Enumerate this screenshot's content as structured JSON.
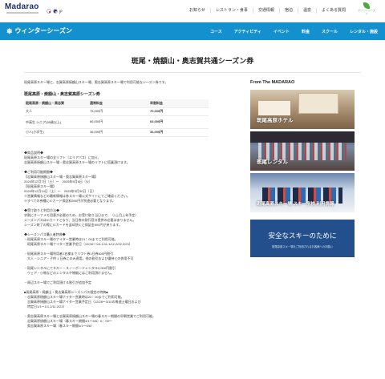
{
  "header": {
    "logo": "Madarao",
    "lang_label": "JP",
    "nav": [
      "お知らせ",
      "レストラン・食事",
      "交通情報",
      "宿泊",
      "温泉",
      "よくある質問"
    ],
    "green_label": "グリーン シーズン"
  },
  "blue_nav": {
    "season": "ウィンターシーズン",
    "menu": [
      "コース",
      "アクティビティ",
      "イベント",
      "料金",
      "スクール",
      "レンタル・施設"
    ]
  },
  "page_title": "斑尾・焼額山・奥志賀共通シーズン券",
  "lead": "斑尾高原スキー場と、志賀高原焼額山スキー場、奥志賀高原スキー場で利用可能なシーズン券です。",
  "table": {
    "title": "斑尾高原・焼額山・奥志賀高原シーズン券",
    "headers": [
      "斑尾高原・焼額山・奥志賀",
      "通常料金",
      "早割料金"
    ],
    "rows": [
      {
        "label": "大人",
        "normal": "75,000円",
        "early": "70,000円"
      },
      {
        "label": "中高生 シニア(55歳以上)",
        "normal": "66,000円",
        "early": "63,000円"
      },
      {
        "label": "小人(小学生)",
        "normal": "36,000円",
        "early": "34,000円"
      }
    ]
  },
  "notes": [
    {
      "text": "◆商品説明◆"
    },
    {
      "text": "斑尾高原スキー場の全リフト（エリアパス）に加え、"
    },
    {
      "text": "志賀高原焼額山スキー場・奥志賀高原スキー場のリフトに搭乗頂けます。"
    },
    {
      "text": ""
    },
    {
      "text": "◆ご利用可能期間◆"
    },
    {
      "text": "【志賀高原焼額山スキー場・奥志賀高原スキー場】"
    },
    {
      "text": "2024年12月7日（土）～　2025年5月6日（火）"
    },
    {
      "text": "【斑尾高原スキー場】"
    },
    {
      "text": "2024年12月14日（土）～　2025年3月30日（日）"
    },
    {
      "text": "※営業情報などの最新情報は各スキー場公式サイトにてご確認ください。"
    },
    {
      "text": "※すべての券種にICカード保証料500円が別途必要となります。"
    },
    {
      "text": ""
    },
    {
      "text": "◆受け取りと利用方法◆"
    },
    {
      "text": "学割にオーナメモ用意が必要のため、お受け取り当日まで、（1上月上旬予定）"
    },
    {
      "text": "シーズンパスはICカードとなり、当日券の発行窓口提供の必要はありません。"
    },
    {
      "text": "シーズン終了の際にICカードを返却頂くと保証金500円が戻ります。"
    },
    {
      "text": ""
    },
    {
      "text": "◆シーズンパス購入者特典◆"
    },
    {
      "text": "・斑尾高原スキー場のナイター営業時は21：00までご利用可能。"
    },
    {
      "text": "　斑尾高原スキー場ナイター営業予定日（12/28～1/4,1/11,1/12,2/22,2/23）"
    },
    {
      "text": ""
    },
    {
      "text": "・斑尾高原スキー場利用者1名様までリフト券1日券500円割引"
    },
    {
      "text": "　大人・シニア・子供 1 日券にのみ適用。他の割引および優待との併用不可"
    },
    {
      "text": ""
    },
    {
      "text": "・斑尾レンタルにてスキー・スノーボードレンタル2,000円割引"
    },
    {
      "text": "　ウェア・小物などのレンタルや物販にはご利用頂けません。"
    },
    {
      "text": ""
    },
    {
      "text": "・周辺スキー場でご利用頂ける割引が追加予定"
    },
    {
      "text": ""
    },
    {
      "text": "■斑尾高原・焼額山・奥志賀高原シーズンパス限定の特典■"
    },
    {
      "text": "・志賀高原焼額山スキー場ナイター営業時は22：00までご利用可能。"
    },
    {
      "text": "　志賀高原焼額山スキー場ナイター営業予定日（12/28～3/10の毎週土曜日および"
    },
    {
      "text": "　特定日1/1～1/1,2/11,2/23）"
    },
    {
      "text": ""
    },
    {
      "text": "・奥志賀高原スキー場と志賀高原焼額山スキー場の春スキー期間の早朝営業でご利用可能。"
    },
    {
      "text": "　志賀高原焼額山スキー場（春スキー期間4/1～5/6）6：00～"
    },
    {
      "text": "　奥志賀高原スキー場（春スキー期間4/1～5/6）"
    }
  ],
  "sidebar": {
    "heading": "From The MADARAO",
    "cards": [
      {
        "label": "斑尾高原ホテル"
      },
      {
        "label": "斑尾レンタル"
      },
      {
        "label": "斑尾高原スキー場 スキー学校 利用情報"
      },
      {
        "title": "安全なスキーのために",
        "sub": "斑尾高原スキー場をご利用されるお客様へのお願い"
      }
    ]
  },
  "colors": {
    "accent_blue": "#1590cf",
    "navy": "#23508c",
    "green": "#4caa3e"
  }
}
